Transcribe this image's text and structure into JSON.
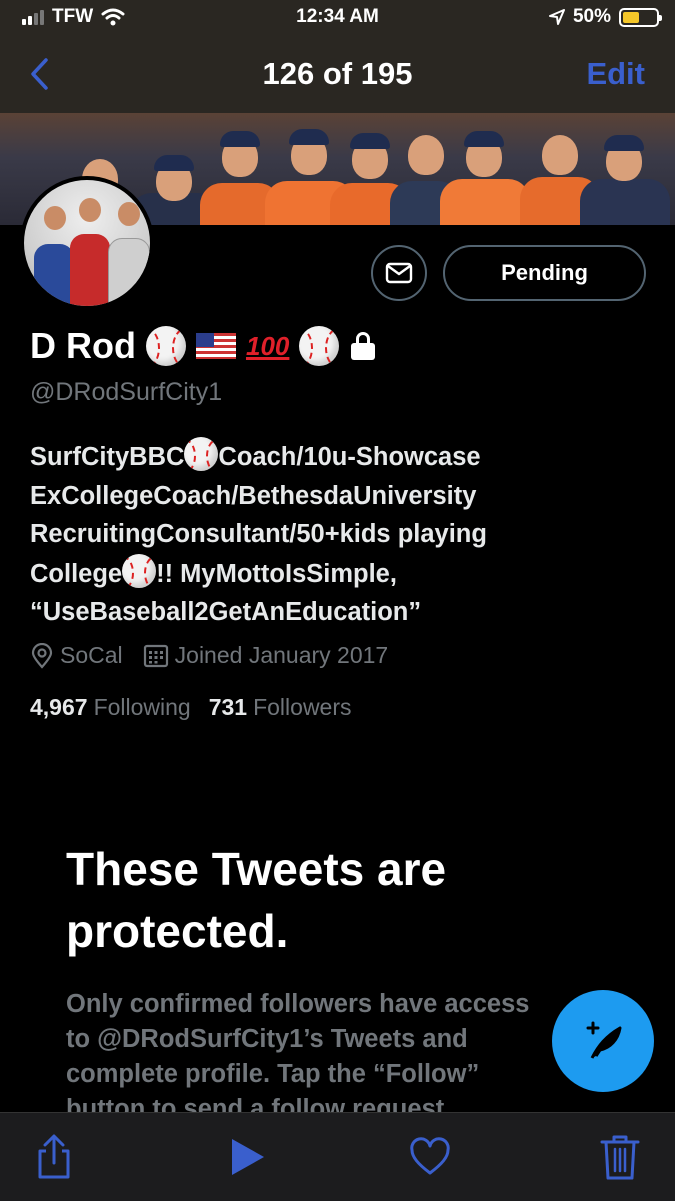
{
  "status_bar": {
    "carrier": "TFW",
    "time": "12:34 AM",
    "battery": "50%",
    "battery_level": 0.5,
    "accent_colors": {
      "battery": "#f4c629"
    }
  },
  "photos_nav": {
    "back_icon": "chevron-left-icon",
    "title": "126 of 195",
    "edit_label": "Edit",
    "accent": "#3a5fcd"
  },
  "profile": {
    "message_icon": "envelope-icon",
    "pending_label": "Pending",
    "display_name": "D Rod",
    "name_emojis": [
      "baseball-icon",
      "us-flag-icon",
      "hundred-points-icon",
      "baseball-icon",
      "lock-icon"
    ],
    "hundred_text": "100",
    "handle": "@DRodSurfCity1",
    "bio": {
      "line1_a": "SurfCityBBC",
      "line1_b": "Coach/10u-Showcase",
      "line2": "ExCollegeCoach/BethesdaUniversity",
      "line3": "RecruitingConsultant/50+kids playing",
      "line4_a": "College",
      "line4_b": "!! MyMottoIsSimple,",
      "line5": "“UseBaseball2GetAnEducation”"
    },
    "location": "SoCal",
    "joined": "Joined January 2017",
    "following_count": "4,967",
    "following_label": "Following",
    "followers_count": "731",
    "followers_label": "Followers"
  },
  "protected": {
    "title": "These Tweets are protected.",
    "body_lines": [
      "Only confirmed followers have access",
      "to @DRodSurfCity1’s Tweets and",
      "complete profile. Tap the “Follow”",
      "button to send a follow request."
    ]
  },
  "compose_fab": {
    "icon": "compose-feather-icon",
    "color": "#1d9bf0"
  },
  "toolbar": {
    "icons": [
      "share-icon",
      "play-icon",
      "heart-icon",
      "trash-icon"
    ],
    "accent": "#3a5fcd"
  }
}
